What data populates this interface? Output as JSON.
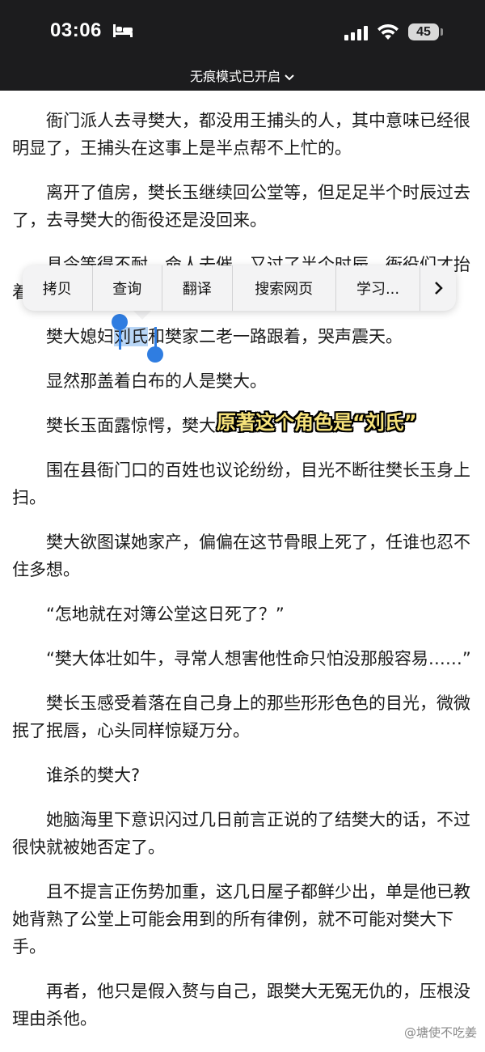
{
  "status_bar": {
    "time": "03:06",
    "battery": "45",
    "icons": [
      "bed-icon",
      "cellular-signal-icon",
      "wifi-icon",
      "battery-icon"
    ]
  },
  "incognito_banner": "无痕模式已开启",
  "context_menu": {
    "items": [
      "拷贝",
      "查询",
      "翻译",
      "搜索网页",
      "学习..."
    ],
    "more_icon": "chevron-right-icon"
  },
  "article": {
    "p1": "衙门派人去寻樊大，都没用王捕头的人，其中意味已经很明显了，王捕头在这事上是半点帮不上忙的。",
    "p2": "离开了值房，樊长玉继续回公堂等，但足足半个时辰过去了，去寻樊大的衙役还是没回来。",
    "p3": "县令等得不耐，命人去催，又过了半个时辰，衙役们才抬着一具盖着白布的尸体回来。",
    "p4_before": "樊大媳妇",
    "p4_selected": "刘氏",
    "p4_after": "和樊家二老一路跟着，哭声震天。",
    "p5": "显然那盖着白布的人是樊大。",
    "p6": "樊长玉面露惊愕，樊大死了？",
    "p7": "围在县衙门口的百姓也议论纷纷，目光不断往樊长玉身上扫。",
    "p8": "樊大欲图谋她家产，偏偏在这节骨眼上死了，任谁也忍不住多想。",
    "p9": "“怎地就在对簿公堂这日死了？”",
    "p10": "“樊大体壮如牛，寻常人想害他性命只怕没那般容易……”",
    "p11": "樊长玉感受着落在自己身上的那些形形色色的目光，微微抿了抿唇，心头同样惊疑万分。",
    "p12": "谁杀的樊大?",
    "p13": "她脑海里下意识闪过几日前言正说的了结樊大的话，不过很快就被她否定了。",
    "p14": "且不提言正伤势加重，这几日屋子都鲜少出，单是他已教她背熟了公堂上可能会用到的所有律例，就不可能对樊大下手。",
    "p15": "再者，他只是假入赘与自己，跟樊大无冤无仇的，压根没理由杀他。"
  },
  "caption": "原著这个角色是“刘氏”",
  "watermark": "@塘使不吃姜"
}
